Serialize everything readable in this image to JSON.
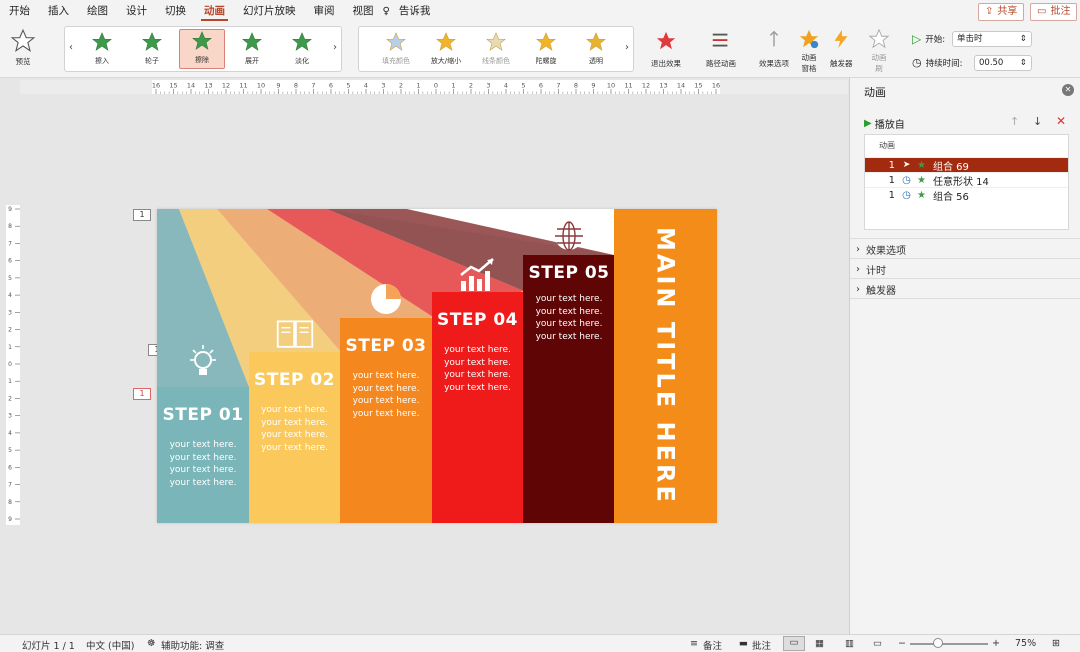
{
  "menu": {
    "items": [
      "开始",
      "插入",
      "绘图",
      "设计",
      "切换",
      "动画",
      "幻灯片放映",
      "审阅",
      "视图",
      "告诉我"
    ],
    "active_index": 5,
    "share_label": "共享",
    "comment_label": "批注"
  },
  "ribbon": {
    "preview_label": "预览",
    "effects": [
      "擦入",
      "轮子",
      "擦除",
      "展开",
      "淡化"
    ],
    "selected_effect": "擦除",
    "emphasis_effects": [
      "填充颜色",
      "放大/缩小",
      "线条颜色",
      "陀螺旋",
      "透明"
    ],
    "exit_label": "退出效果",
    "path_label": "路径动画",
    "effect_options_label": "效果选项",
    "anim_pane_label": "动画\n窗格",
    "trigger_label": "触发器",
    "anim_brush_label": "动画\n刷",
    "start_label": "开始:",
    "start_value": "单击时",
    "duration_label": "持续时间:",
    "duration_value": "00.50"
  },
  "ruler": {
    "h_ticks": [
      "16",
      "15",
      "14",
      "13",
      "12",
      "11",
      "10",
      "9",
      "8",
      "7",
      "6",
      "5",
      "4",
      "3",
      "2",
      "1",
      "0",
      "1",
      "2",
      "3",
      "4",
      "5",
      "6",
      "7",
      "8",
      "9",
      "10",
      "11",
      "12",
      "13",
      "14",
      "15",
      "16"
    ],
    "v_ticks": [
      "9",
      "8",
      "7",
      "6",
      "5",
      "4",
      "3",
      "2",
      "1",
      "0",
      "1",
      "2",
      "3",
      "4",
      "5",
      "6",
      "7",
      "8",
      "9"
    ]
  },
  "slide": {
    "tags": [
      "1",
      "1",
      "1"
    ],
    "steps": [
      {
        "label": "STEP 01",
        "text": [
          "your text here.",
          "your text here.",
          "your text here.",
          "your text here."
        ],
        "color": "#7ab5b9",
        "icon": "lightbulb-icon"
      },
      {
        "label": "STEP 02",
        "text": [
          "your text here.",
          "your text here.",
          "your text here.",
          "your text here."
        ],
        "color": "#fbc95b",
        "icon": "book-icon"
      },
      {
        "label": "STEP 03",
        "text": [
          "your text here.",
          "your text here.",
          "your text here.",
          "your text here."
        ],
        "color": "#f5871f",
        "icon": "pie-chart-icon"
      },
      {
        "label": "STEP 04",
        "text": [
          "your text here.",
          "your text here.",
          "your text here.",
          "your text here."
        ],
        "color": "#ef1a1a",
        "icon": "growth-chart-icon"
      },
      {
        "label": "STEP 05",
        "text": [
          "your text here.",
          "your text here.",
          "your text here.",
          "your text here."
        ],
        "color": "#5f0505",
        "icon": "globe-icon"
      }
    ],
    "main_title": "MAIN TITLE HERE",
    "main_title_color": "#f48c1a"
  },
  "anim_pane": {
    "title": "动画",
    "play_from_label": "播放自",
    "list_header": "动画",
    "rows": [
      {
        "num": "1",
        "name": "组合 69",
        "selected": true,
        "icon": "cursor-icon"
      },
      {
        "num": "1",
        "name": "任意形状 14",
        "selected": false,
        "icon": "clock-icon"
      },
      {
        "num": "1",
        "name": "组合 56",
        "selected": false,
        "icon": "clock-icon"
      }
    ],
    "sections": [
      "效果选项",
      "计时",
      "触发器"
    ]
  },
  "status": {
    "slide_label": "幻灯片 1 / 1",
    "language": "中文 (中国)",
    "accessibility": "辅助功能: 调查",
    "notes_label": "备注",
    "comments_label": "批注",
    "zoom": "75%"
  },
  "colors": {
    "accent": "#b7472a",
    "selected_row": "#a22a0f"
  }
}
